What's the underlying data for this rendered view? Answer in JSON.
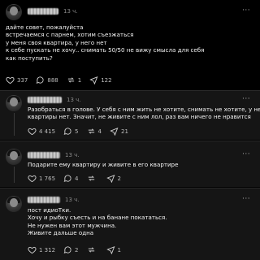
{
  "posts": [
    {
      "time": "13 ч.",
      "more": "···",
      "lines": [
        "дайте совет, пожалуйста",
        "встречаемся с парнем, хотим съезжаться",
        "у меня своя квартира, у него нет",
        "к себе пускать не хочу.. снимать 50/50 не вижу смысла для себя",
        "как поступить?"
      ],
      "likes": "337",
      "comments": "888",
      "reposts": "1",
      "shares": "122"
    },
    {
      "time": "13 ч.",
      "more": "···",
      "lines": [
        "Разобраться в голове. У себя с ним жить не хотите, снимать не хотите, у него",
        "квартиры нет. Значит, не живите с ним лол, раз вам ничего не нравится"
      ],
      "likes": "4 415",
      "comments": "5",
      "reposts": "4",
      "shares": "21"
    },
    {
      "time": "13 ч.",
      "more": "···",
      "lines": [
        "Подарите ему квартиру и живите в его квартире"
      ],
      "likes": "1 765",
      "comments": "4",
      "reposts": "",
      "shares": "2"
    },
    {
      "time": "13 ч.",
      "more": "···",
      "lines": [
        "пост идиоТки.",
        "Хочу и рыбку съесть и на банане покататься.",
        "Не нужен вам этот мужчина.",
        "Живите дальше одна"
      ],
      "likes": "1 312",
      "comments": "2",
      "reposts": "",
      "shares": "1"
    }
  ]
}
